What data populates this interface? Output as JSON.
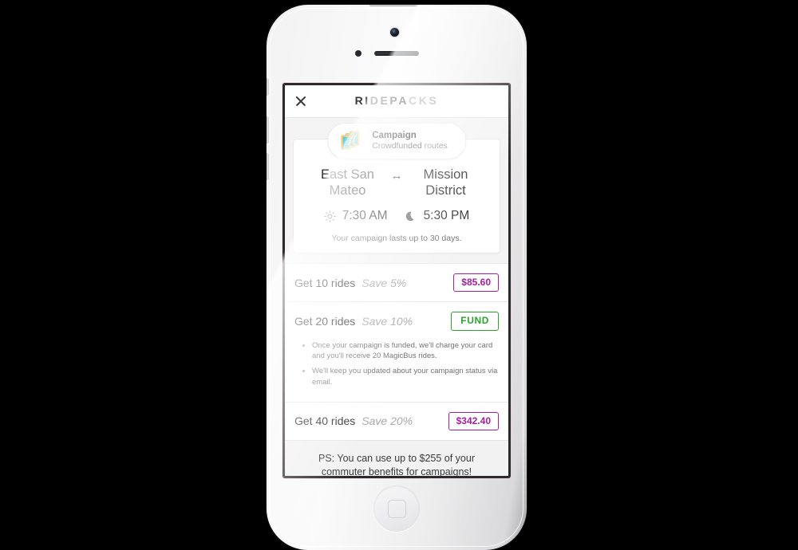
{
  "app": {
    "title_dark": "RIDEPA",
    "title_light": "CKS",
    "close_label": "×"
  },
  "campaign_pill": {
    "icon": "map-cards-icon",
    "title": "Campaign",
    "subtitle_strong": "Crowdfunded",
    "subtitle_rest": " routes"
  },
  "route": {
    "origin": "East San Mateo",
    "arrow": "↔",
    "destination": "Mission District",
    "morning": {
      "icon": "sun-icon",
      "time": "7:30 AM"
    },
    "evening": {
      "icon": "moon-icon",
      "time": "5:30 PM"
    },
    "note": "Your campaign lasts up to 30 days."
  },
  "packs": [
    {
      "label": "Get 10 rides",
      "save": "Save 5%",
      "action": "$85.60",
      "action_kind": "price",
      "expanded": false,
      "details": []
    },
    {
      "label": "Get 20 rides",
      "save": "Save 10%",
      "action": "FUND",
      "action_kind": "fund",
      "expanded": true,
      "details": [
        "Once your campaign is funded, we'll charge your card and you'll receive 20 MagicBus rides.",
        "We'll keep you updated about your campaign status via email."
      ]
    },
    {
      "label": "Get 40 rides",
      "save": "Save 20%",
      "action": "$342.40",
      "action_kind": "price",
      "expanded": false,
      "details": []
    }
  ],
  "footer": {
    "note": "PS: You can use up to $255 of your commuter benefits for campaigns!"
  },
  "colors": {
    "price_accent": "#a3219b",
    "fund_accent": "#2ea32e",
    "title_dark": "#3a3a3c",
    "title_light": "#a9a9ab",
    "icon_teal": "#4ec9d4",
    "icon_border": "#f0c97a"
  }
}
